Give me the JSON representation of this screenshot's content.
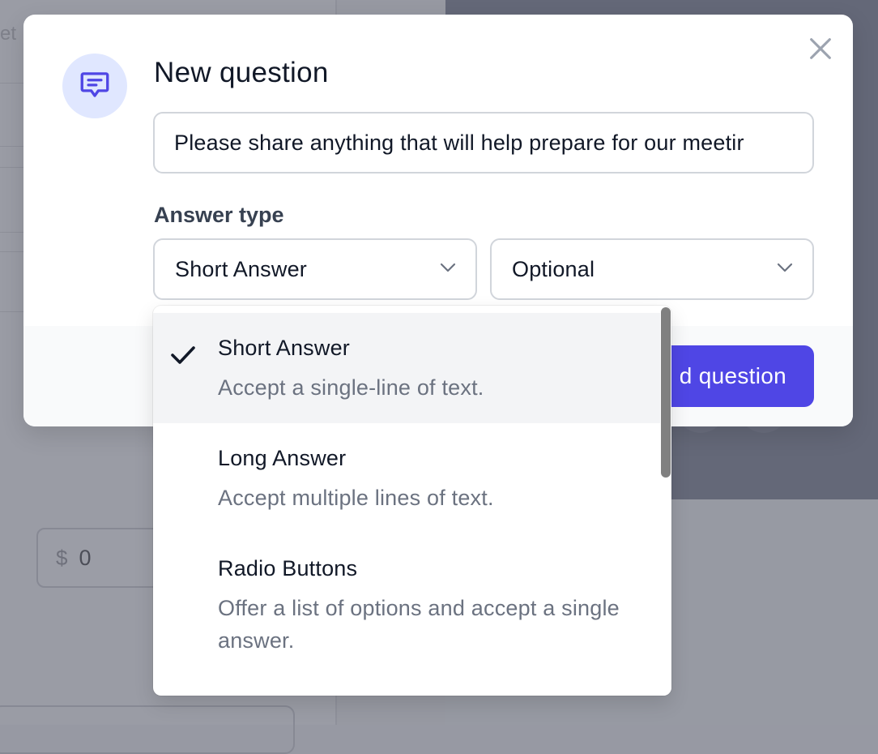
{
  "background": {
    "partial_text": "et",
    "price_currency": "$",
    "price_value": "0"
  },
  "modal": {
    "icon": "chat-bubble-icon",
    "title": "New question",
    "question_value": "Please share anything that will help prepare for our meetir",
    "answer_type_label": "Answer type",
    "answer_type_selected": "Short Answer",
    "requirement_selected": "Optional",
    "submit_label": "d question",
    "close_icon": "close-icon"
  },
  "dropdown": {
    "options": [
      {
        "title": "Short Answer",
        "description": "Accept a single-line of text.",
        "selected": true
      },
      {
        "title": "Long Answer",
        "description": "Accept multiple lines of text.",
        "selected": false
      },
      {
        "title": "Radio Buttons",
        "description": "Offer a list of options and accept a single answer.",
        "selected": false
      }
    ]
  },
  "colors": {
    "accent": "#4f46e5",
    "icon_bg": "#e0e7ff",
    "selected_row": "#f3f4f6"
  }
}
